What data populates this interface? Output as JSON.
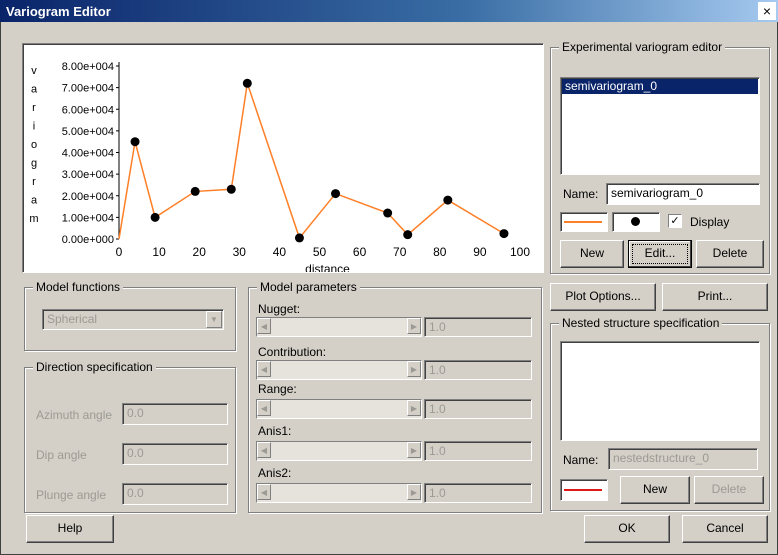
{
  "window": {
    "title": "Variogram Editor",
    "close_glyph": "×"
  },
  "chart_data": {
    "type": "line",
    "x": [
      4,
      9,
      19,
      28,
      32,
      45,
      54,
      67,
      72,
      82,
      96
    ],
    "y": [
      45000,
      10000,
      22000,
      23000,
      72000,
      500,
      21000,
      12000,
      2000,
      18000,
      2500
    ],
    "xlim": [
      0,
      100
    ],
    "ylim": [
      0,
      80000
    ],
    "xticks": [
      "0",
      "10",
      "20",
      "30",
      "40",
      "50",
      "60",
      "70",
      "80",
      "90",
      "100"
    ],
    "yticks": [
      "0.00e+000",
      "1.00e+004",
      "2.00e+004",
      "3.00e+004",
      "4.00e+004",
      "5.00e+004",
      "6.00e+004",
      "7.00e+004",
      "8.00e+004"
    ],
    "xlabel": "distance",
    "ylabel": "variogram",
    "line_color": "#ff7f27",
    "marker_color": "#000000"
  },
  "experimental": {
    "group_label": "Experimental variogram editor",
    "list_items": [
      "semivariogram_0"
    ],
    "name_label": "Name:",
    "name_value": "semivariogram_0",
    "display_label": "Display",
    "display_checked": true,
    "new_label": "New",
    "edit_label": "Edit...",
    "delete_label": "Delete"
  },
  "model_functions": {
    "group_label": "Model functions",
    "selected": "Spherical"
  },
  "direction": {
    "group_label": "Direction specification",
    "azimuth_label": "Azimuth angle",
    "azimuth_value": "0.0",
    "dip_label": "Dip angle",
    "dip_value": "0.0",
    "plunge_label": "Plunge angle",
    "plunge_value": "0.0"
  },
  "model_parameters": {
    "group_label": "Model parameters",
    "nugget_label": "Nugget:",
    "nugget_value": "1.0",
    "contribution_label": "Contribution:",
    "contribution_value": "1.0",
    "range_label": "Range:",
    "range_value": "1.0",
    "anis1_label": "Anis1:",
    "anis1_value": "1.0",
    "anis2_label": "Anis2:",
    "anis2_value": "1.0"
  },
  "plot_options_label": "Plot Options...",
  "print_label": "Print...",
  "nested": {
    "group_label": "Nested structure specification",
    "name_label": "Name:",
    "name_value": "nestedstructure_0",
    "new_label": "New",
    "delete_label": "Delete",
    "line_color": "#e01818"
  },
  "help_label": "Help",
  "ok_label": "OK",
  "cancel_label": "Cancel"
}
